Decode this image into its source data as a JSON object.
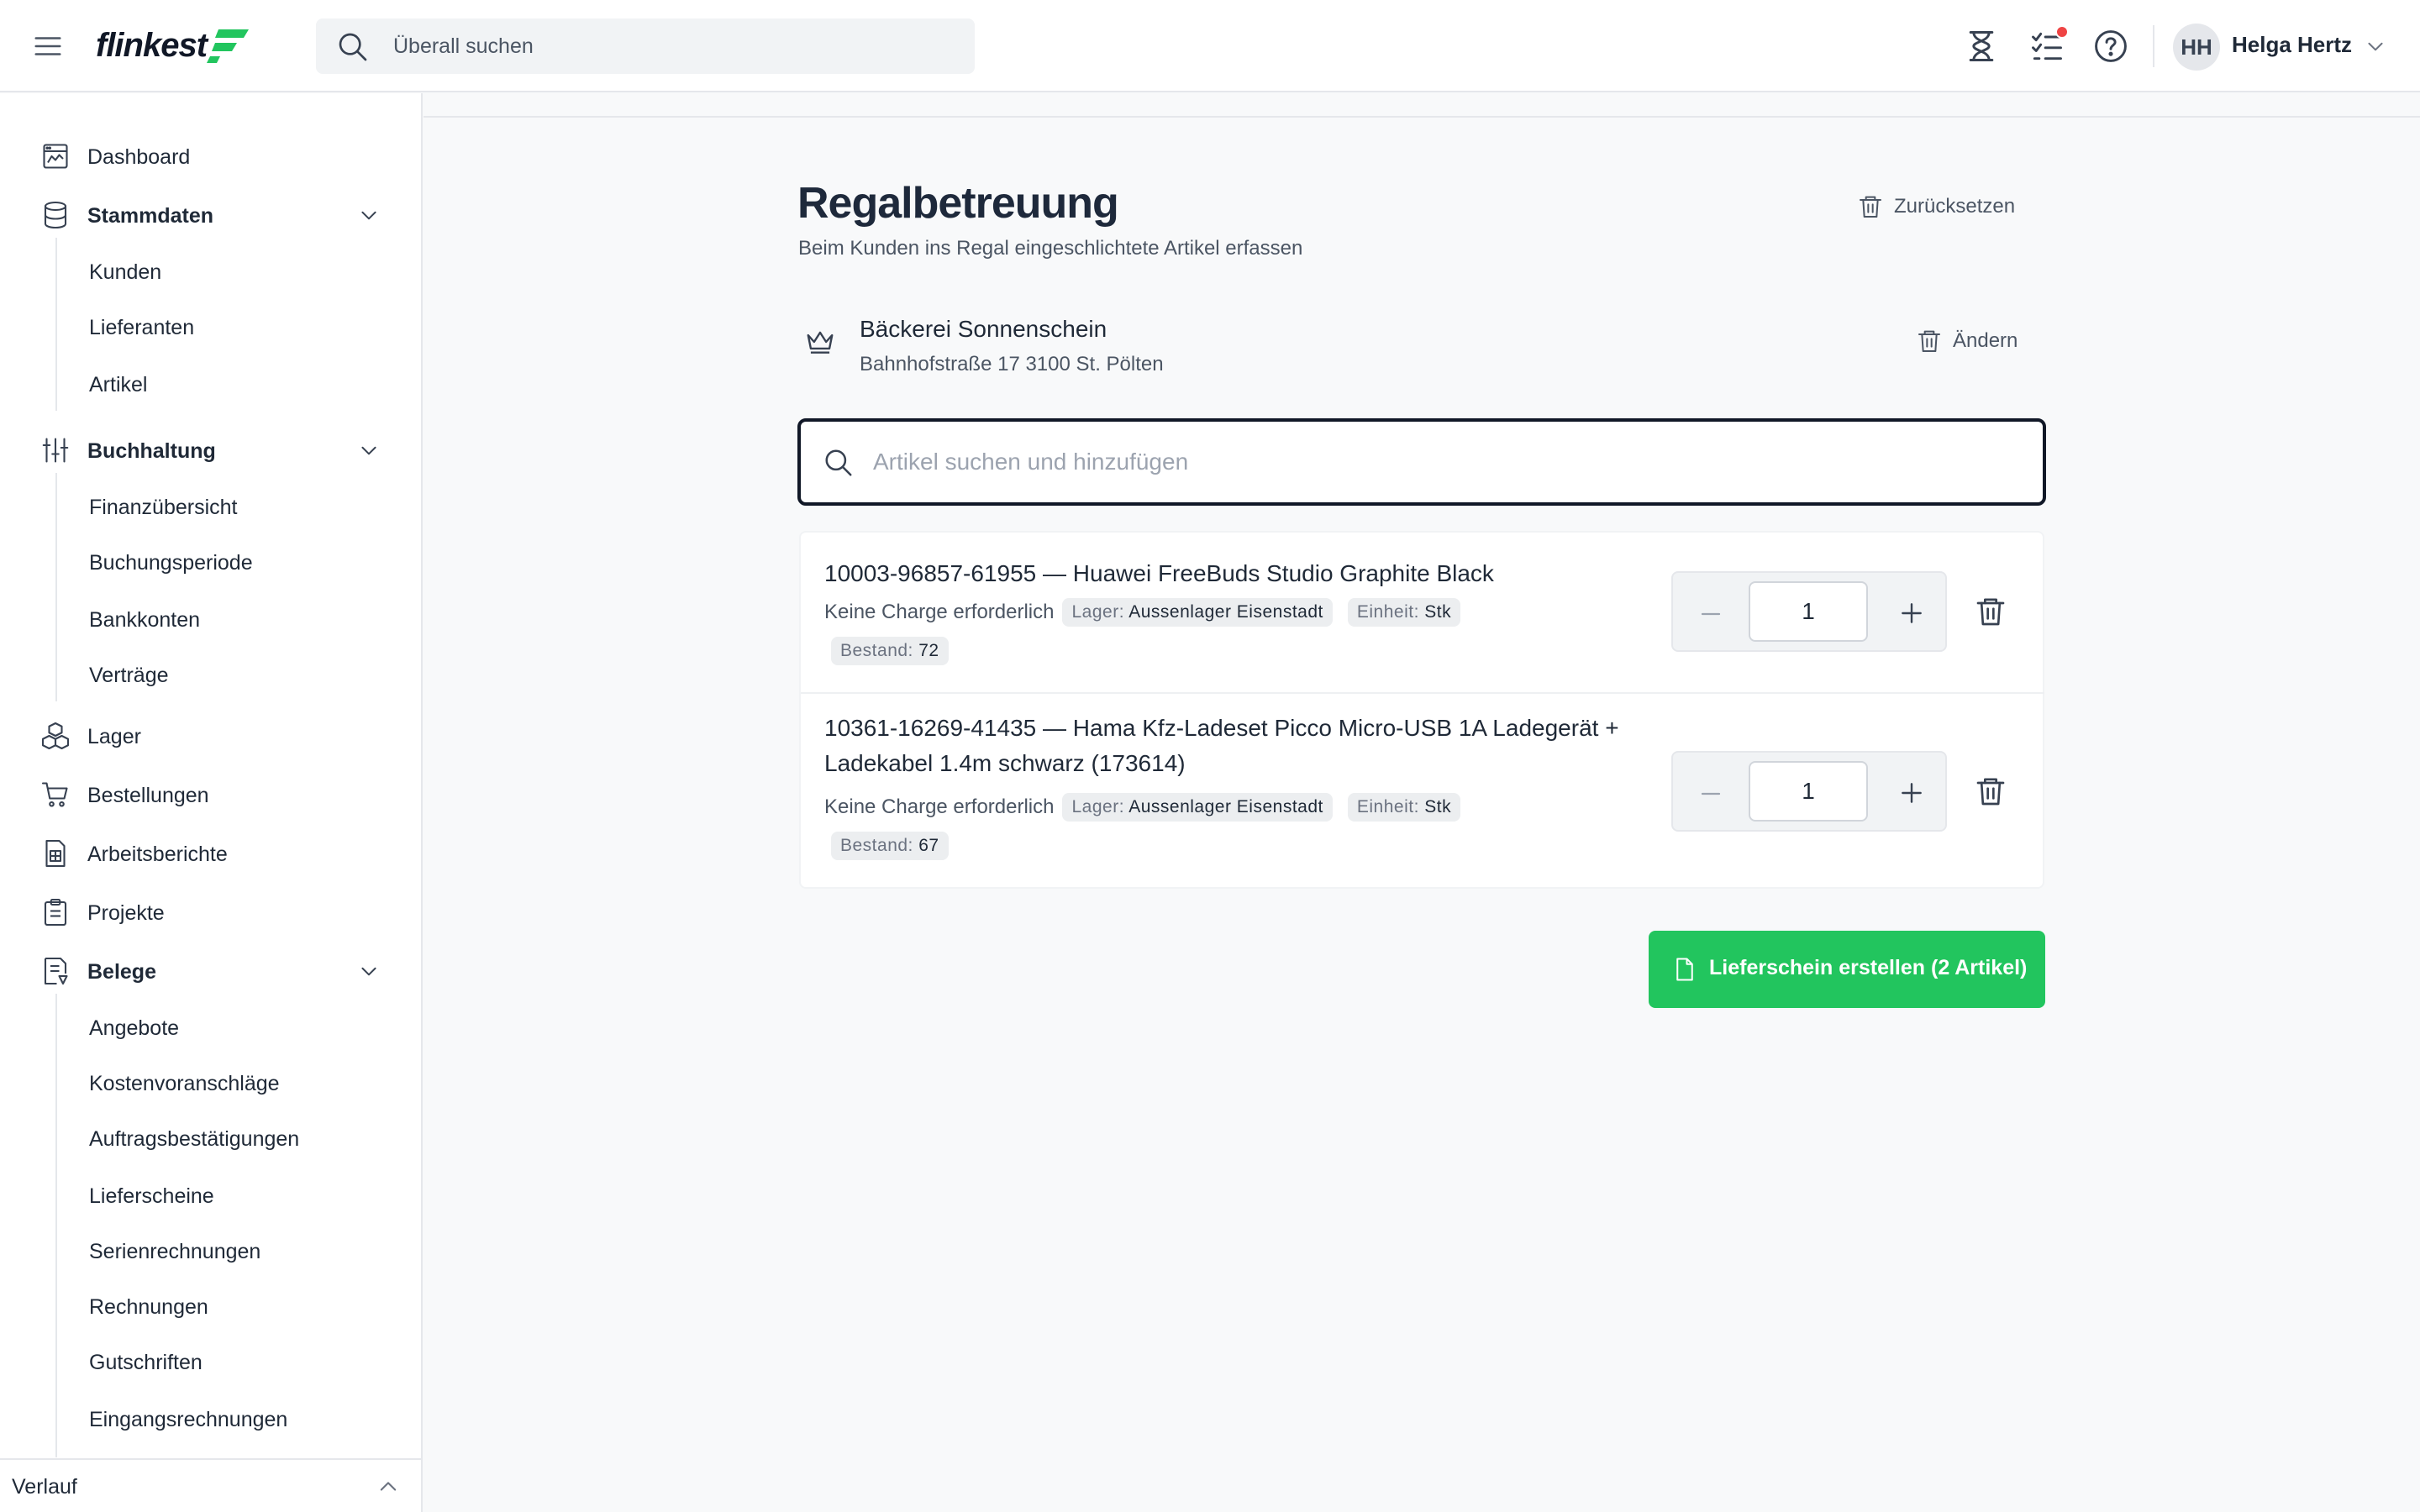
{
  "app": {
    "logo_text": "flinkest",
    "brand_color": "#22c55e"
  },
  "header": {
    "search_placeholder": "Überall suchen",
    "avatar_initials": "HH",
    "user_name": "Helga Hertz",
    "icons": [
      "menu-icon",
      "hourglass-icon",
      "tasks-icon",
      "help-icon",
      "chevron-down-icon"
    ]
  },
  "sidebar": {
    "items": [
      {
        "label": "Dashboard",
        "icon": "dashboard-icon"
      },
      {
        "label": "Stammdaten",
        "icon": "database-icon",
        "expanded": true,
        "children": [
          "Kunden",
          "Lieferanten",
          "Artikel"
        ]
      },
      {
        "label": "Buchhaltung",
        "icon": "sliders-icon",
        "expanded": true,
        "children": [
          "Finanzübersicht",
          "Buchungsperiode",
          "Bankkonten",
          "Verträge"
        ]
      },
      {
        "label": "Lager",
        "icon": "boxes-icon"
      },
      {
        "label": "Bestellungen",
        "icon": "cart-icon"
      },
      {
        "label": "Arbeitsberichte",
        "icon": "report-icon"
      },
      {
        "label": "Projekte",
        "icon": "clipboard-icon"
      },
      {
        "label": "Belege",
        "icon": "receipt-icon",
        "expanded": true,
        "children": [
          "Angebote",
          "Kostenvoranschläge",
          "Auftragsbestätigungen",
          "Lieferscheine",
          "Serienrechnungen",
          "Rechnungen",
          "Gutschriften",
          "Eingangsrechnungen"
        ]
      }
    ],
    "footer_label": "Verlauf"
  },
  "main": {
    "title": "Regalbetreuung",
    "subtitle": "Beim Kunden ins Regal eingeschlichtete Artikel erfassen",
    "reset_label": "Zurücksetzen",
    "customer": {
      "name": "Bäckerei Sonnenschein",
      "address": "Bahnhofstraße 17 3100 St. Pölten",
      "change_label": "Ändern"
    },
    "article_search_placeholder": "Artikel suchen und hinzufügen",
    "badge_labels": {
      "lager": "Lager:",
      "einheit": "Einheit:",
      "bestand": "Bestand:"
    },
    "items": [
      {
        "title": "10003-96857-61955 — Huawei FreeBuds Studio Graphite Black",
        "charge": "Keine Charge erforderlich",
        "lager": "Aussenlager Eisenstadt",
        "einheit": "Stk",
        "bestand": "72",
        "quantity": "1"
      },
      {
        "title": "10361-16269-41435 — Hama Kfz-Ladeset Picco Micro-USB 1A Ladegerät + Ladekabel 1.4m schwarz (173614)",
        "charge": "Keine Charge erforderlich",
        "lager": "Aussenlager Eisenstadt",
        "einheit": "Stk",
        "bestand": "67",
        "quantity": "1"
      }
    ],
    "create_button_label": "Lieferschein erstellen (2 Artikel)"
  }
}
